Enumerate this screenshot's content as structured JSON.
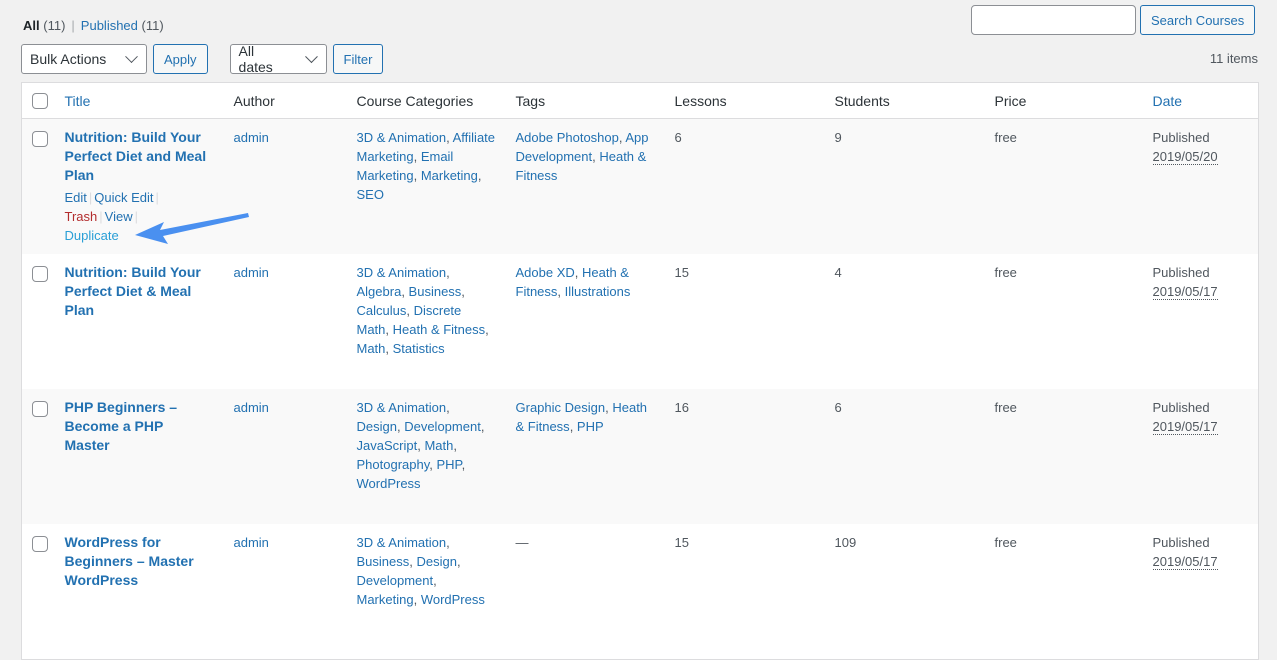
{
  "views": {
    "all_label": "All",
    "all_count": "(11)",
    "separator": "|",
    "published_label": "Published",
    "published_count": "(11)"
  },
  "search": {
    "value": "",
    "placeholder": "",
    "button_label": "Search Courses"
  },
  "toolbar": {
    "bulk_actions_selected": "Bulk Actions",
    "apply_label": "Apply",
    "dates_selected": "All dates",
    "filter_label": "Filter",
    "items_count": "11 items"
  },
  "table": {
    "columns": {
      "title": "Title",
      "author": "Author",
      "categories": "Course Categories",
      "tags": "Tags",
      "lessons": "Lessons",
      "students": "Students",
      "price": "Price",
      "date": "Date"
    },
    "row_actions": {
      "edit": "Edit",
      "quick_edit": "Quick Edit",
      "trash": "Trash",
      "view": "View",
      "duplicate": "Duplicate"
    },
    "rows": [
      {
        "title": "Nutrition: Build Your Perfect Diet and Meal Plan",
        "author": "admin",
        "categories": [
          "3D & Animation",
          "Affiliate Marketing",
          "Email Marketing",
          "Marketing",
          "SEO"
        ],
        "tags": [
          "Adobe Photoshop",
          "App Development",
          "Heath & Fitness"
        ],
        "lessons": "6",
        "students": "9",
        "price": "free",
        "status": "Published",
        "date": "2019/05/20"
      },
      {
        "title": "Nutrition: Build Your Perfect Diet & Meal Plan",
        "author": "admin",
        "categories": [
          "3D & Animation",
          "Algebra",
          "Business",
          "Calculus",
          "Discrete Math",
          "Heath & Fitness",
          "Math",
          "Statistics"
        ],
        "tags": [
          "Adobe XD",
          "Heath & Fitness",
          "Illustrations"
        ],
        "lessons": "15",
        "students": "4",
        "price": "free",
        "status": "Published",
        "date": "2019/05/17"
      },
      {
        "title": "PHP Beginners – Become a PHP Master",
        "author": "admin",
        "categories": [
          "3D & Animation",
          "Design",
          "Development",
          "JavaScript",
          "Math",
          "Photography",
          "PHP",
          "WordPress"
        ],
        "tags": [
          "Graphic Design",
          "Heath & Fitness",
          "PHP"
        ],
        "lessons": "16",
        "students": "6",
        "price": "free",
        "status": "Published",
        "date": "2019/05/17"
      },
      {
        "title": "WordPress for Beginners – Master WordPress",
        "author": "admin",
        "categories": [
          "3D & Animation",
          "Business",
          "Design",
          "Development",
          "Marketing",
          "WordPress"
        ],
        "tags": [],
        "tags_empty": "—",
        "lessons": "15",
        "students": "109",
        "price": "free",
        "status": "Published",
        "date": "2019/05/17"
      }
    ]
  },
  "annotation": {
    "arrow_color": "#4a90f0"
  }
}
